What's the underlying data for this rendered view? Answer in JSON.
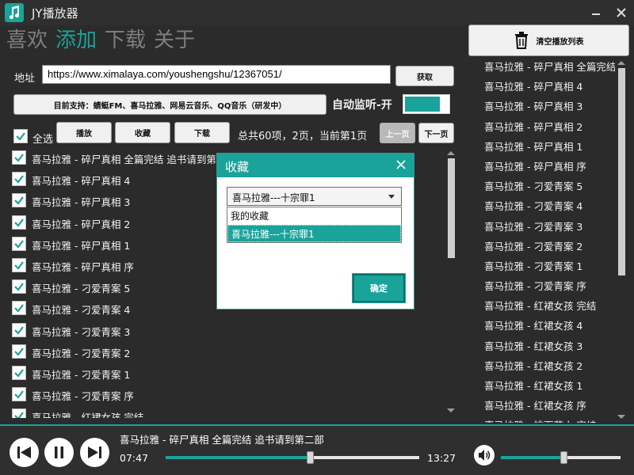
{
  "window": {
    "title": "JY播放器"
  },
  "nav": {
    "tabs": [
      "喜欢",
      "添加",
      "下载",
      "关于"
    ],
    "active_index": 1
  },
  "address": {
    "label": "地址",
    "value": "https://www.ximalaya.com/youshengshu/12367051/",
    "fetch_label": "获取"
  },
  "support_text": "目前支持：蜻蜓FM、喜马拉雅、网易云音乐、QQ音乐（研发中）",
  "monitor": {
    "label": "自动监听-开",
    "on": true
  },
  "toolbar": {
    "select_all": "全选",
    "play": "播放",
    "favorite": "收藏",
    "download": "下载",
    "status": "总共60项，2页，当前第1页",
    "prev_page": "上一页",
    "next_page": "下一页"
  },
  "items": [
    "喜马拉雅 - 碎尸真相 全篇完结 追书请到第二部",
    "喜马拉雅 - 碎尸真相 4",
    "喜马拉雅 - 碎尸真相 3",
    "喜马拉雅 - 碎尸真相 2",
    "喜马拉雅 - 碎尸真相 1",
    "喜马拉雅 - 碎尸真相 序",
    "喜马拉雅 - 刁爱青案 5",
    "喜马拉雅 - 刁爱青案 4",
    "喜马拉雅 - 刁爱青案 3",
    "喜马拉雅 - 刁爱青案 2",
    "喜马拉雅 - 刁爱青案 1",
    "喜马拉雅 - 刁爱青案 序",
    "喜马拉雅 - 红裙女孩 完结"
  ],
  "playlist": {
    "clear_label": "清空播放列表",
    "items": [
      "喜马拉雅 - 碎尸真相 全篇完结",
      "喜马拉雅 - 碎尸真相 4",
      "喜马拉雅 - 碎尸真相 3",
      "喜马拉雅 - 碎尸真相 2",
      "喜马拉雅 - 碎尸真相 1",
      "喜马拉雅 - 碎尸真相 序",
      "喜马拉雅 - 刁爱青案 5",
      "喜马拉雅 - 刁爱青案 4",
      "喜马拉雅 - 刁爱青案 3",
      "喜马拉雅 - 刁爱青案 2",
      "喜马拉雅 - 刁爱青案 1",
      "喜马拉雅 - 刁爱青案 序",
      "喜马拉雅 - 红裙女孩 完结",
      "喜马拉雅 - 红裙女孩 4",
      "喜马拉雅 - 红裙女孩 3",
      "喜马拉雅 - 红裙女孩 2",
      "喜马拉雅 - 红裙女孩 1",
      "喜马拉雅 - 红裙女孩 序",
      "喜马拉雅 - 桃下花人 完结"
    ]
  },
  "player": {
    "now_playing": "喜马拉雅 - 碎尸真相 全篇完结 追书请到第二部",
    "elapsed": "07:47",
    "total": "13:27",
    "progress": 0.57,
    "volume": 0.52
  },
  "dialog": {
    "title": "收藏",
    "selected": "喜马拉雅---十宗罪1",
    "options": [
      "我的收藏",
      "喜马拉雅---十宗罪1"
    ],
    "ok_label": "确定"
  },
  "colors": {
    "accent": "#1aa39a",
    "background": "#2b2b2b"
  },
  "icons": [
    "music-note-icon",
    "minimize-icon",
    "close-icon",
    "trash-icon",
    "prev-icon",
    "pause-icon",
    "next-icon",
    "volume-icon"
  ]
}
